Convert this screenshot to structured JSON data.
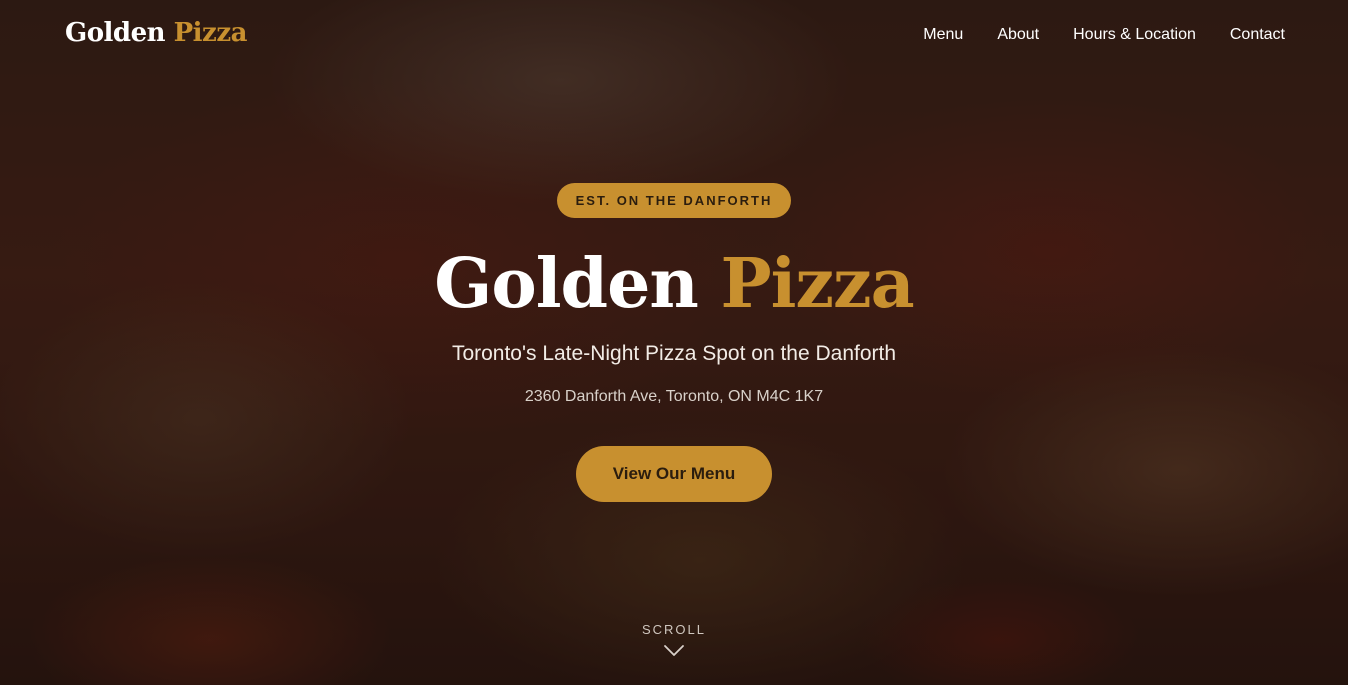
{
  "brand": {
    "name_part1": "Golden",
    "name_part2": "Pizza"
  },
  "nav": {
    "items": [
      {
        "label": "Menu"
      },
      {
        "label": "About"
      },
      {
        "label": "Hours & Location"
      },
      {
        "label": "Contact"
      }
    ]
  },
  "hero": {
    "badge": "EST. ON THE DANFORTH",
    "title_part1": "Golden",
    "title_part2": "Pizza",
    "tagline": "Toronto's Late-Night Pizza Spot on the Danforth",
    "address": "2360 Danforth Ave, Toronto, ON M4C 1K7",
    "cta_label": "View Our Menu"
  },
  "scroll": {
    "label": "SCROLL",
    "icon": "chevron-down-icon"
  },
  "colors": {
    "accent": "#c8902f",
    "text_light": "#ffffff",
    "background_dark": "#2a1510"
  }
}
